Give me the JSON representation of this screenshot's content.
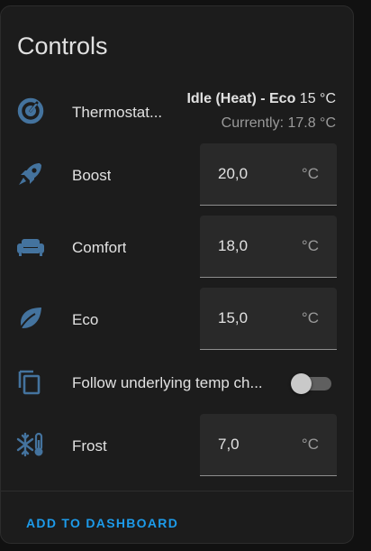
{
  "card": {
    "title": "Controls",
    "accent_color": "#1d9bea",
    "icon_color": "#44739e"
  },
  "thermostat": {
    "label": "Thermostat...",
    "state_bold": "Idle (Heat) - Eco",
    "target": "15 °C",
    "current": "Currently: 17.8 °C",
    "icon": "thermostat-dial-icon"
  },
  "presets": [
    {
      "label": "Boost",
      "value": "20,0",
      "unit": "°C",
      "icon": "rocket-icon"
    },
    {
      "label": "Comfort",
      "value": "18,0",
      "unit": "°C",
      "icon": "sofa-icon"
    },
    {
      "label": "Eco",
      "value": "15,0",
      "unit": "°C",
      "icon": "leaf-icon"
    }
  ],
  "follow": {
    "label": "Follow underlying temp ch...",
    "icon": "copy-icon",
    "enabled": false
  },
  "frost": {
    "label": "Frost",
    "value": "7,0",
    "unit": "°C",
    "icon": "snowflake-thermometer-icon"
  },
  "footer": {
    "button_label": "ADD TO DASHBOARD"
  }
}
